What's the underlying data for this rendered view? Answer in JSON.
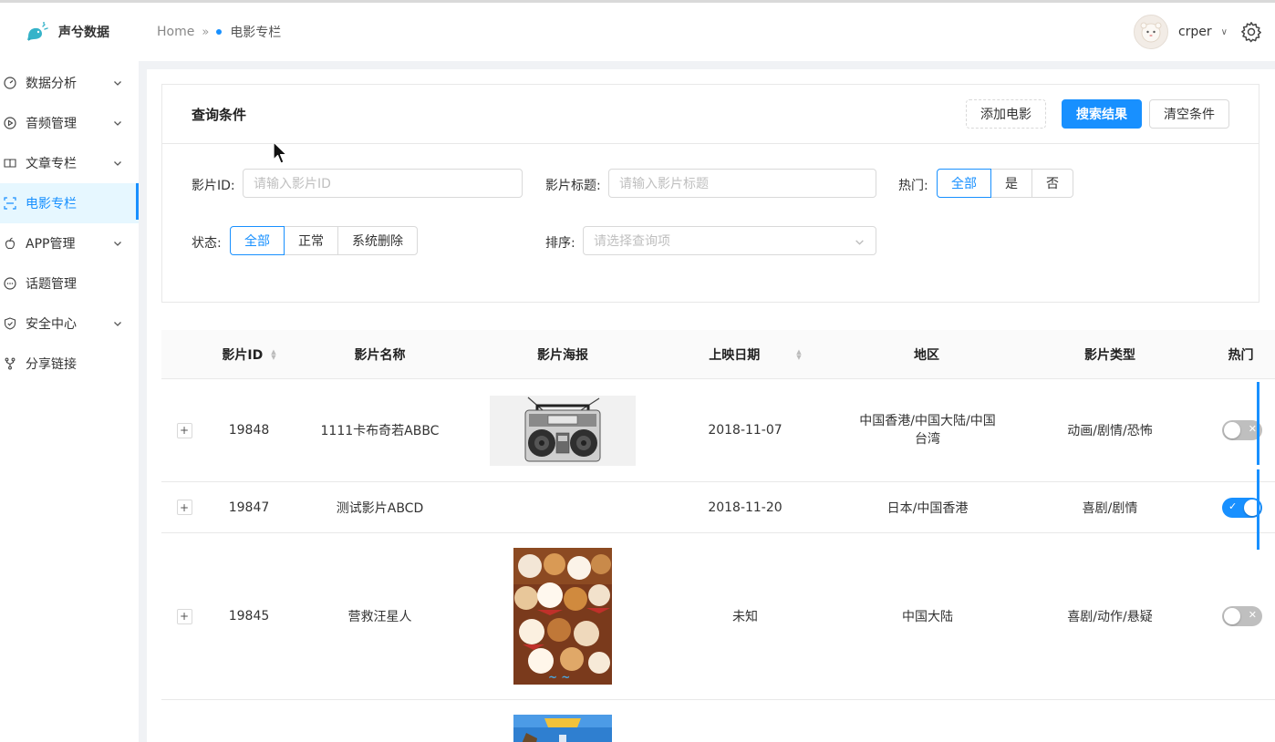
{
  "app": {
    "name": "声兮数据"
  },
  "breadcrumb": {
    "home": "Home",
    "current": "电影专栏"
  },
  "user": {
    "name": "crper"
  },
  "sidebar": {
    "items": [
      {
        "label": "数据分析",
        "icon": "dashboard-icon",
        "has_children": true
      },
      {
        "label": "音频管理",
        "icon": "play-circle-icon",
        "has_children": true
      },
      {
        "label": "文章专栏",
        "icon": "book-icon",
        "has_children": true
      },
      {
        "label": "电影专栏",
        "icon": "scan-icon",
        "has_children": false,
        "active": true
      },
      {
        "label": "APP管理",
        "icon": "apple-icon",
        "has_children": true
      },
      {
        "label": "话题管理",
        "icon": "message-icon",
        "has_children": false
      },
      {
        "label": "安全中心",
        "icon": "shield-icon",
        "has_children": true
      },
      {
        "label": "分享链接",
        "icon": "fork-icon",
        "has_children": false
      }
    ]
  },
  "query": {
    "title": "查询条件",
    "add_button": "添加电影",
    "search_button": "搜索结果",
    "clear_button": "清空条件",
    "movie_id_label": "影片ID:",
    "movie_id_placeholder": "请输入影片ID",
    "movie_title_label": "影片标题:",
    "movie_title_placeholder": "请输入影片标题",
    "hot_label": "热门:",
    "hot_options": [
      "全部",
      "是",
      "否"
    ],
    "hot_selected": "全部",
    "status_label": "状态:",
    "status_options": [
      "全部",
      "正常",
      "系统删除"
    ],
    "status_selected": "全部",
    "sort_label": "排序:",
    "sort_placeholder": "请选择查询项"
  },
  "table": {
    "columns": [
      "影片ID",
      "影片名称",
      "影片海报",
      "上映日期",
      "地区",
      "影片类型",
      "热门"
    ],
    "rows": [
      {
        "id": "19848",
        "name": "1111卡布奇若ABBC",
        "poster": "boombox-poster",
        "date": "2018-11-07",
        "region": "中国香港/中国大陆/中国台湾",
        "genre": "动画/剧情/恐怖",
        "hot": false
      },
      {
        "id": "19847",
        "name": "测试影片ABCD",
        "poster": "",
        "date": "2018-11-20",
        "region": "日本/中国香港",
        "genre": "喜剧/剧情",
        "hot": true
      },
      {
        "id": "19845",
        "name": "营救汪星人",
        "poster": "dogs-poster",
        "date": "未知",
        "region": "中国大陆",
        "genre": "喜剧/动作/悬疑",
        "hot": false
      },
      {
        "id": "",
        "name": "",
        "poster": "blue-poster",
        "date": "",
        "region": "",
        "genre": "",
        "hot": null
      }
    ]
  },
  "colors": {
    "primary": "#1890ff",
    "sidebar_active_bg": "#e6f7ff",
    "switch_off": "#bfbfbf"
  }
}
